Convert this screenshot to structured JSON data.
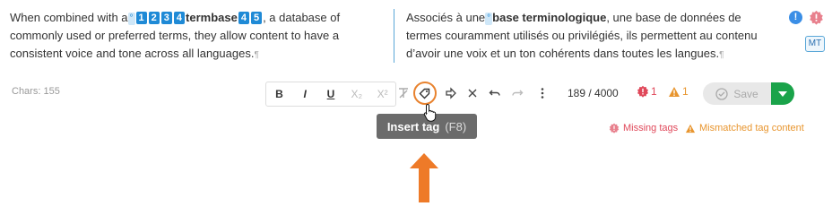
{
  "editor": {
    "source": {
      "before_tag": "When combined with a",
      "tag_start": "°",
      "tags_open": [
        "1",
        "2",
        "3",
        "4"
      ],
      "term": "termbase",
      "tags_close": [
        "4",
        "5"
      ],
      "after": ", a database of commonly used or preferred terms, they allow content to have a consistent voice and tone across all languages.",
      "pilcrow": "¶"
    },
    "target": {
      "before_tag": "Associés à une",
      "tag_start": "°",
      "term": "base terminologique",
      "after": ", une base de données de termes couramment utilisés ou privilégiés, ils permettent au contenu d’avoir une voix et un ton cohérents dans toutes les langues.",
      "pilcrow": "¶"
    },
    "side_badges": {
      "info": "!",
      "mt": "MT"
    }
  },
  "toolbar": {
    "chars_label": "Chars: 155",
    "format_buttons": [
      "B",
      "I",
      "U",
      "X₂",
      "X²"
    ],
    "counter": "189 / 4000",
    "qa_errors": "1",
    "qa_warnings": "1",
    "save_label": "Save"
  },
  "tooltip": {
    "label": "Insert tag",
    "shortcut": "(F8)"
  },
  "legend": {
    "missing_tags": "Missing tags",
    "mismatched_tag_content": "Mismatched tag content"
  },
  "colors": {
    "accent": "#1f8ad6",
    "error": "#e0485a",
    "warning": "#e8952e",
    "highlight": "#e8822e",
    "save_green": "#1aa34a"
  },
  "icons": [
    "clear-format-icon",
    "insert-tag-icon",
    "copy-source-icon",
    "close-icon",
    "undo-icon",
    "redo-icon",
    "more-vertical-icon",
    "check-circle-icon",
    "chevron-down-icon"
  ]
}
